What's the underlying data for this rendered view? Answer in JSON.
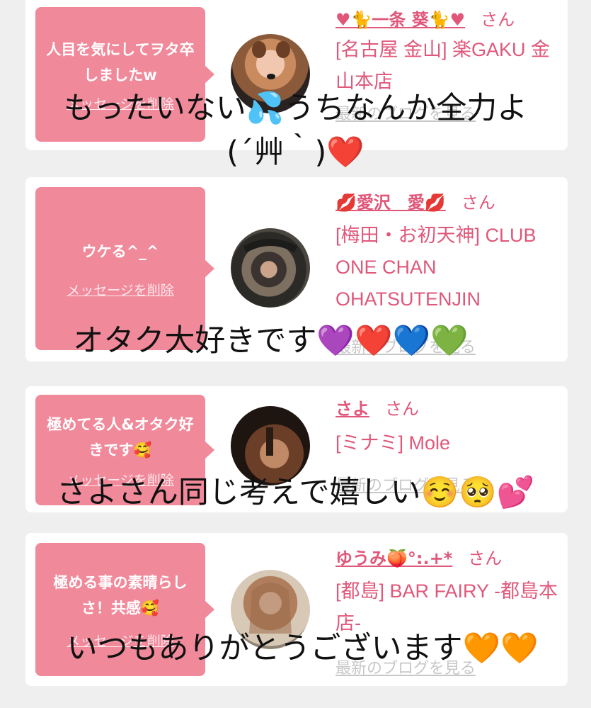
{
  "cards": [
    {
      "comment": "人目を気にしてヲタ卒しましたw",
      "delete_label": "メッセージを削除",
      "cast_name": "♥🐈一条 葵🐈♥",
      "honorific": "さん",
      "shop": "[名古屋 金山] 楽GAKU 金山本店",
      "blog_label": "最新のブログを見る",
      "avatar_icon": "avatar-photo"
    },
    {
      "comment": "ウケる^_^",
      "delete_label": "メッセージを削除",
      "cast_name": "💋愛沢　愛💋",
      "honorific": "さん",
      "shop": "[梅田・お初天神] CLUB ONE CHAN OHATSUTENJIN",
      "blog_label": "最新のブログを見る",
      "avatar_icon": "avatar-photo"
    },
    {
      "comment": "極めてる人&オタク好きです🥰",
      "delete_label": "メッセージを削除",
      "cast_name": "さよ",
      "honorific": "さん",
      "shop": "[ミナミ] Mole",
      "blog_label": "最新のブログを見る",
      "avatar_icon": "avatar-photo"
    },
    {
      "comment": "極める事の素晴らしさ！共感🥰",
      "delete_label": "メッセージを削除",
      "cast_name": "ゆうみ🍑°:.+*",
      "honorific": "さん",
      "shop": "[都島] BAR FAIRY -都島本店-",
      "blog_label": "最新のブログを見る",
      "avatar_icon": "avatar-photo"
    }
  ],
  "captions": [
    "もったいない💦うちなんか全力よ",
    "(´艸｀)❤️",
    "オタク大好きです💜❤️💙💚",
    "さよさん同じ考えで嬉しい☺️🥺💕",
    "いつもありがとうございます🧡🧡"
  ],
  "colors": {
    "background": "#efefef",
    "bubble": "#f08a9b",
    "accent_text": "#e0577a",
    "blog_link": "#c7c7c7"
  }
}
